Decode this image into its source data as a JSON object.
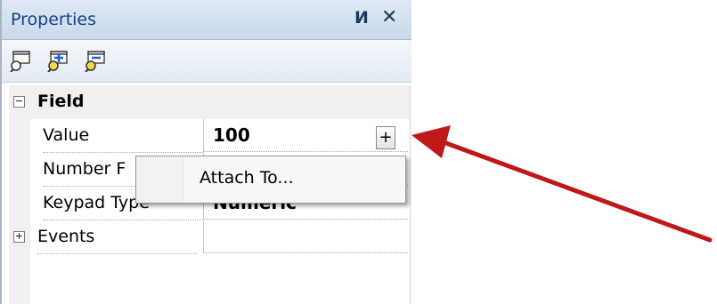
{
  "panel": {
    "title": "Properties",
    "pin_glyph": "И",
    "close_glyph": "✕"
  },
  "toolbar": {
    "buttons": [
      {
        "icon": "categorized-icon"
      },
      {
        "icon": "add-item-icon"
      },
      {
        "icon": "remove-item-icon"
      }
    ]
  },
  "grid": {
    "category": {
      "label": "Field",
      "expander": "−"
    },
    "rows": [
      {
        "name": "Value",
        "value": "100"
      },
      {
        "name": "Number F",
        "value": ""
      },
      {
        "name": "Keypad Type",
        "value": "Numeric"
      }
    ],
    "events": {
      "label": "Events",
      "expander": "+"
    },
    "value_button": "+"
  },
  "context_menu": {
    "items": [
      {
        "label": "Attach To..."
      }
    ]
  },
  "colors": {
    "arrow": "#c01818",
    "title_text": "#15428b"
  }
}
